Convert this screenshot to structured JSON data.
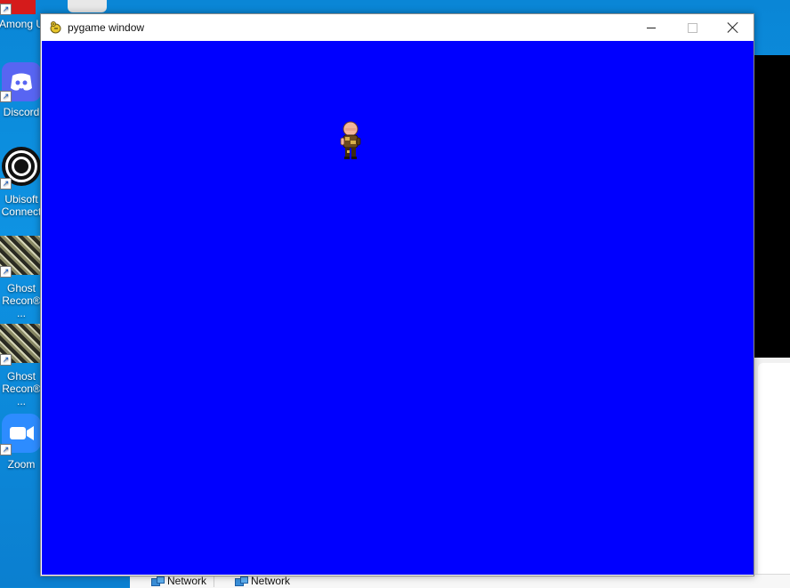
{
  "desktop": {
    "icons": [
      {
        "name": "among-us",
        "label": "Among U"
      },
      {
        "name": "discord",
        "label": "Discord"
      },
      {
        "name": "ubisoft-connect",
        "label": "Ubisoft Connect"
      },
      {
        "name": "ghost-recon-1",
        "label": "Ghost Recon® ..."
      },
      {
        "name": "ghost-recon-2",
        "label": "Ghost Recon® ..."
      },
      {
        "name": "zoom",
        "label": "Zoom"
      }
    ],
    "explorer_items": [
      "Network",
      "Network"
    ]
  },
  "window": {
    "title": "pygame window",
    "controls": {
      "minimize": "minimize",
      "maximize": "maximize",
      "close": "close"
    },
    "canvas_color": "#0000ff"
  }
}
